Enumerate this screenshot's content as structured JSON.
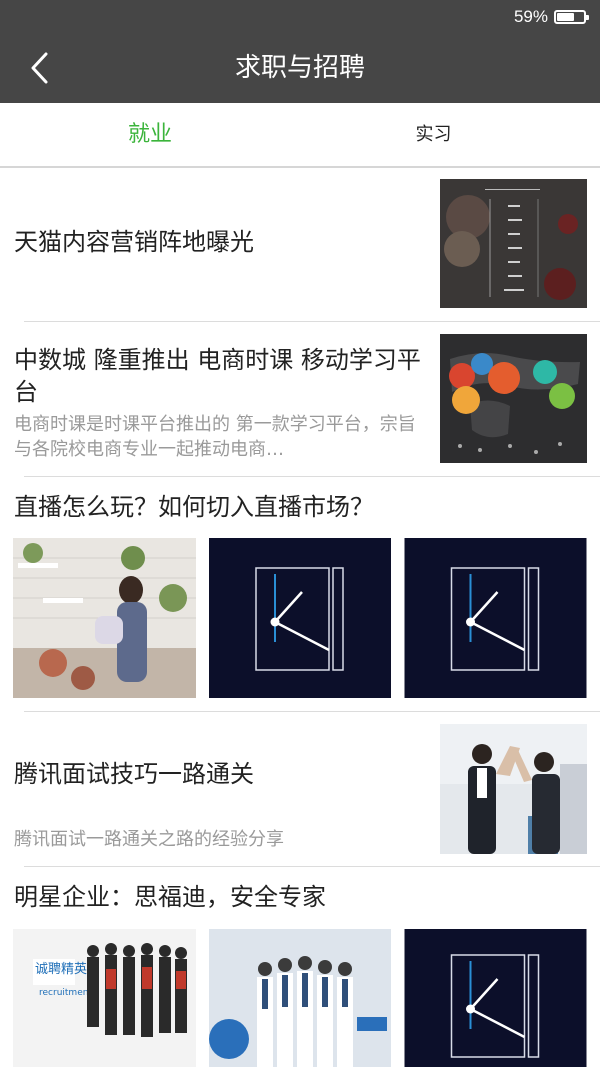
{
  "status": {
    "battery": "59%",
    "battery_level": 0.59
  },
  "header": {
    "title": "求职与招聘",
    "back_icon": "chevron-left-icon"
  },
  "tabs": [
    {
      "label": "就业",
      "active": true
    },
    {
      "label": "实习",
      "active": false
    }
  ],
  "colors": {
    "header_bg": "#464646",
    "active_tab": "#3bb43b",
    "text": "#222222",
    "subtext": "#9a9a9a",
    "tile_bg": "#0c0f2a"
  },
  "feed": [
    {
      "title": "天猫内容营销阵地曝光"
    },
    {
      "title": "中数城 隆重推出 电商时课 移动学习平台",
      "desc": "电商时课是时课平台推出的 第一款学习平台，宗旨与各院校电商专业一起推动电商…"
    },
    {
      "title": "直播怎么玩？如何切入直播市场？"
    },
    {
      "title": "腾讯面试技巧一路通关",
      "desc": "腾讯面试一路通关之路的经验分享"
    },
    {
      "title": "明星企业：思福迪，安全专家"
    }
  ]
}
